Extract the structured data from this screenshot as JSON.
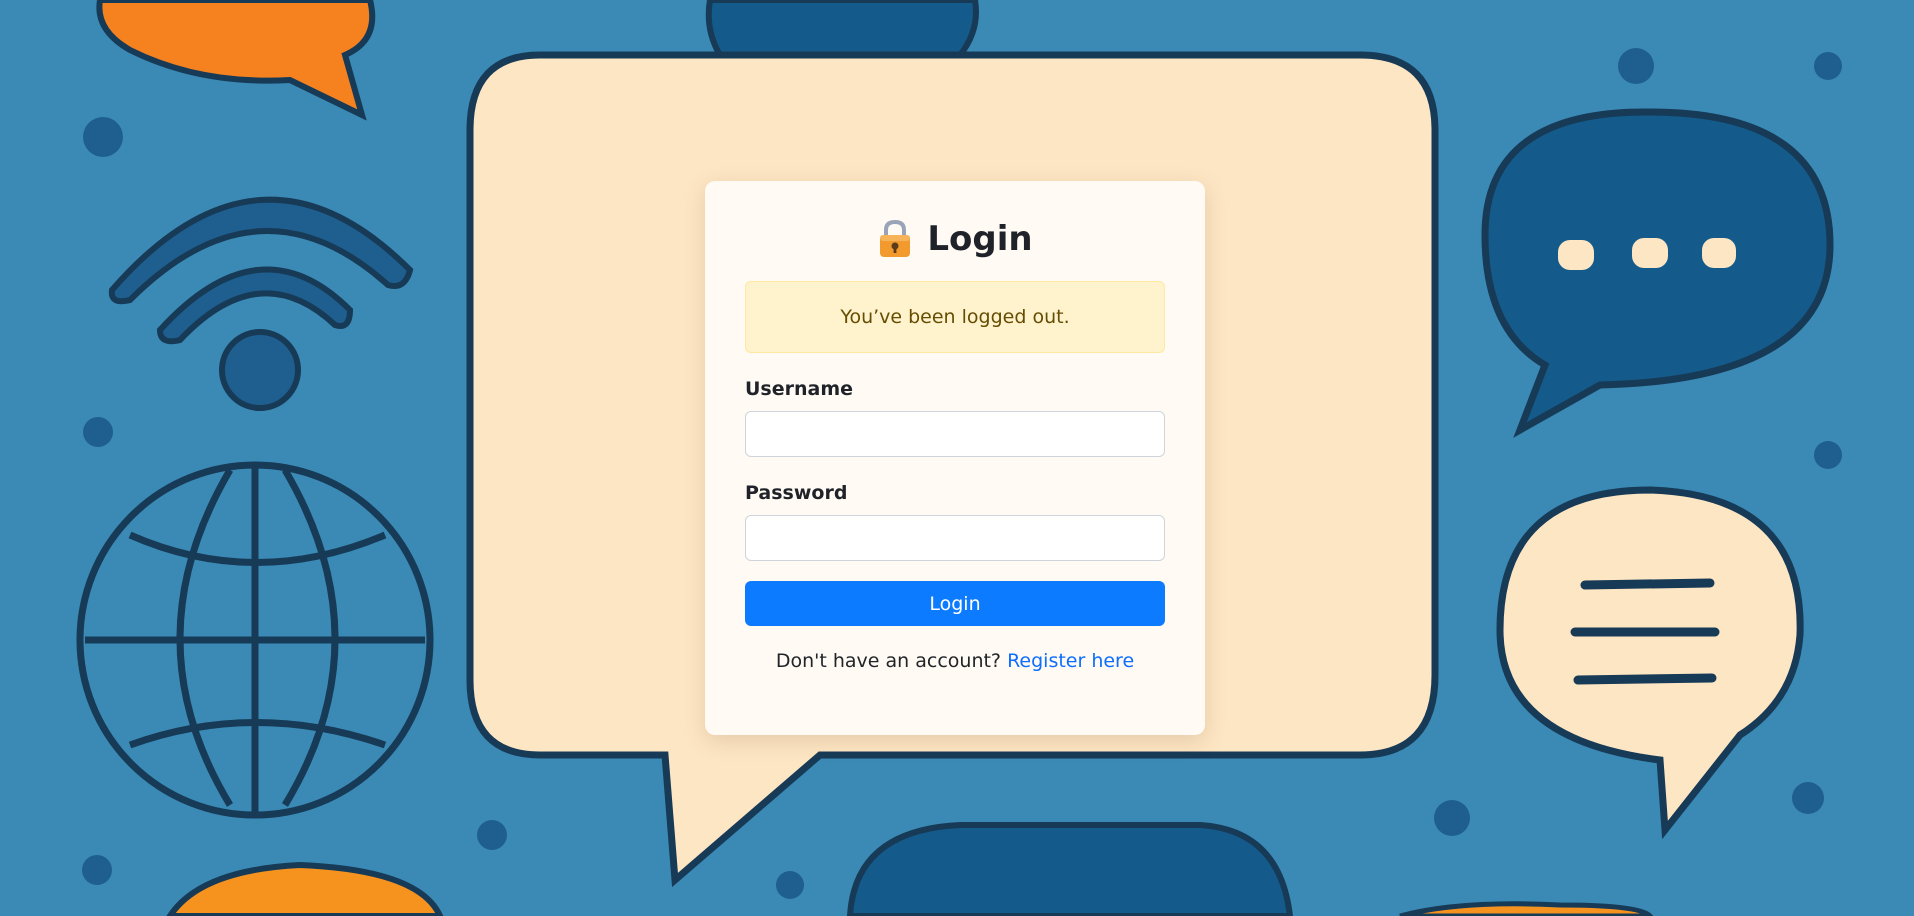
{
  "login": {
    "title": "Login",
    "alert": "You’ve been logged out.",
    "username_label": "Username",
    "username_value": "",
    "password_label": "Password",
    "password_value": "",
    "submit_label": "Login",
    "footer_text": "Don't have an account?",
    "register_link": "Register here"
  },
  "icons": {
    "title_icon": "lock-icon"
  },
  "colors": {
    "background": "#3a8ab5",
    "bubble": "#fde6c4",
    "primary": "#0d7bff",
    "link": "#0d6efd",
    "alert_bg": "#fff3cd",
    "alert_text": "#664d03"
  }
}
